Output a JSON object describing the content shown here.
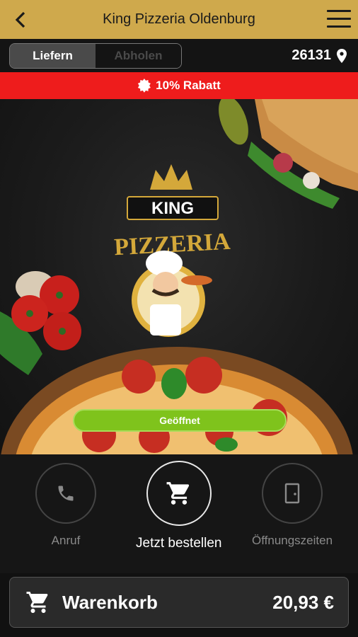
{
  "header": {
    "title": "King Pizzeria Oldenburg",
    "back_icon": "back-arrow-icon",
    "menu_icon": "hamburger-menu-icon"
  },
  "mode": {
    "options": [
      "Liefern",
      "Abholen"
    ],
    "selected": "Liefern"
  },
  "location": {
    "zip": "26131",
    "icon": "map-pin-icon"
  },
  "promo": {
    "text": "10% Rabatt",
    "icon": "badge-icon"
  },
  "hero": {
    "logo_top": "KING",
    "logo_bottom": "PIZZERIA",
    "status": "Geöffnet"
  },
  "actions": [
    {
      "label": "Anruf",
      "icon": "phone-icon"
    },
    {
      "label": "Jetzt bestellen",
      "icon": "cart-icon"
    },
    {
      "label": "Öffnungszeiten",
      "icon": "door-icon"
    }
  ],
  "cart": {
    "label": "Warenkorb",
    "total": "20,93 €",
    "icon": "cart-icon"
  },
  "colors": {
    "header": "#cfa94c",
    "promo": "#ee1c1c",
    "status": "#7fc31c",
    "background": "#161616"
  }
}
